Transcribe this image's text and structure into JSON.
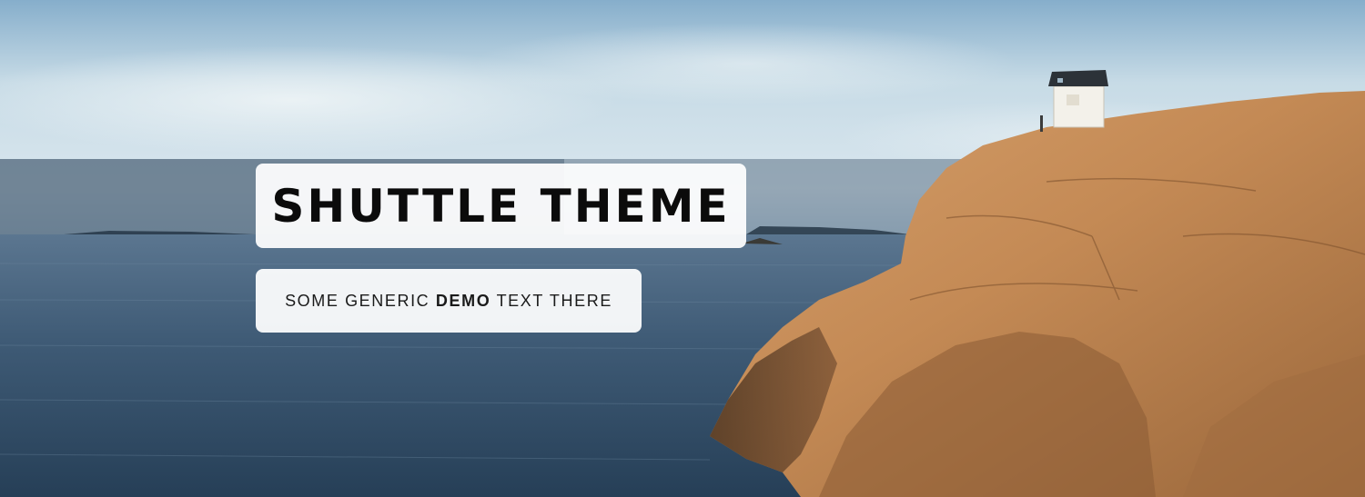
{
  "hero": {
    "title": "SHUTTLE THEME",
    "subtitle": {
      "before": "SOME GENERIC ",
      "emphasis": "DEMO",
      "after": " TEXT THERE"
    },
    "colors": {
      "sky_top": "#7fa9c6",
      "sea": "#3a5570",
      "rock": "#c58f58",
      "box_bg": "#ffffff",
      "text": "#0b0b0b"
    }
  }
}
